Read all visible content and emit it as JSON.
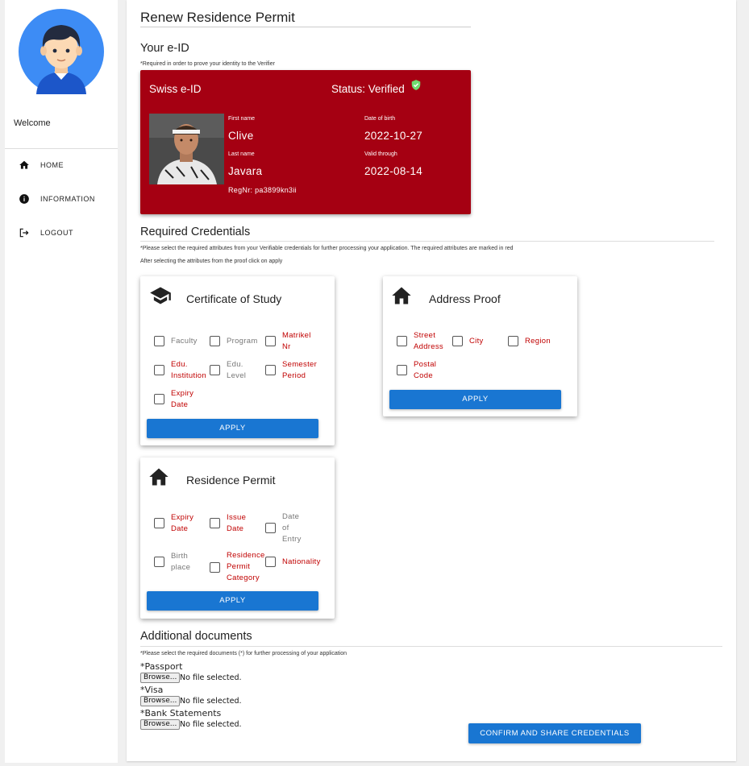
{
  "sidebar": {
    "welcome": "Welcome",
    "items": [
      {
        "label": "HOME",
        "icon": "home-icon"
      },
      {
        "label": "INFORMATION",
        "icon": "info-icon"
      },
      {
        "label": "LOGOUT",
        "icon": "logout-icon"
      }
    ]
  },
  "page": {
    "title": "Renew Residence Permit"
  },
  "eid": {
    "section_title": "Your e-ID",
    "note": "*Required in order to prove your identity to the Verifier",
    "card": {
      "issuer": "Swiss e-ID",
      "status": "Status: Verified",
      "first_name_label": "First name",
      "first_name": "Clive",
      "last_name_label": "Last name",
      "last_name": "Javara",
      "dob_label": "Date of birth",
      "dob": "2022-10-27",
      "valid_label": "Valid through",
      "valid": "2022-08-14",
      "reg": "RegNr: pa3899kn3ii"
    }
  },
  "credentials": {
    "section_title": "Required Credentials",
    "note1": "*Please select the required attributes from your Verifiable credentials for further processing your application. The required attributes are marked in red",
    "note2": "After selecting the attributes from the proof click on apply",
    "apply_label": "APPLY",
    "study": {
      "title": "Certificate of Study",
      "options": [
        {
          "lines": [
            "Faculty"
          ],
          "required": false
        },
        {
          "lines": [
            "Program"
          ],
          "required": false
        },
        {
          "lines": [
            "Matrikel",
            "Nr"
          ],
          "required": true
        },
        {
          "lines": [
            "Edu.",
            "Institution"
          ],
          "required": true
        },
        {
          "lines": [
            "Edu.",
            "Level"
          ],
          "required": false
        },
        {
          "lines": [
            "Semester",
            "Period"
          ],
          "required": true
        },
        {
          "lines": [
            "Expiry",
            "Date"
          ],
          "required": true
        }
      ]
    },
    "address": {
      "title": "Address Proof",
      "options": [
        {
          "lines": [
            "Street",
            "Address"
          ],
          "required": true
        },
        {
          "lines": [
            "City"
          ],
          "required": true
        },
        {
          "lines": [
            "Region"
          ],
          "required": true
        },
        {
          "lines": [
            "Postal",
            "Code"
          ],
          "required": true
        }
      ]
    },
    "residence": {
      "title": "Residence Permit",
      "options": [
        {
          "lines": [
            "Expiry",
            "Date"
          ],
          "required": true
        },
        {
          "lines": [
            "Issue",
            "Date"
          ],
          "required": true
        },
        {
          "lines": [
            "Date",
            "of",
            "Entry"
          ],
          "required": false
        },
        {
          "lines": [
            "Birth",
            "place"
          ],
          "required": false
        },
        {
          "lines": [
            "Residence",
            "Permit",
            "Category"
          ],
          "required": true
        },
        {
          "lines": [
            "Nationality"
          ],
          "required": true
        }
      ]
    }
  },
  "documents": {
    "section_title": "Additional documents",
    "note": "*Please select the required documents (*) for further processing of your application",
    "browse_label": "Browse...",
    "no_file": "No file selected.",
    "items": [
      "*Passport",
      "*Visa",
      "*Bank Statements"
    ]
  },
  "confirm_label": "CONFIRM AND SHARE CREDENTIALS",
  "colors": {
    "brand_red": "#a50012",
    "primary_blue": "#1976d2",
    "required_red": "#c00000",
    "verified_green": "#4caf50"
  }
}
